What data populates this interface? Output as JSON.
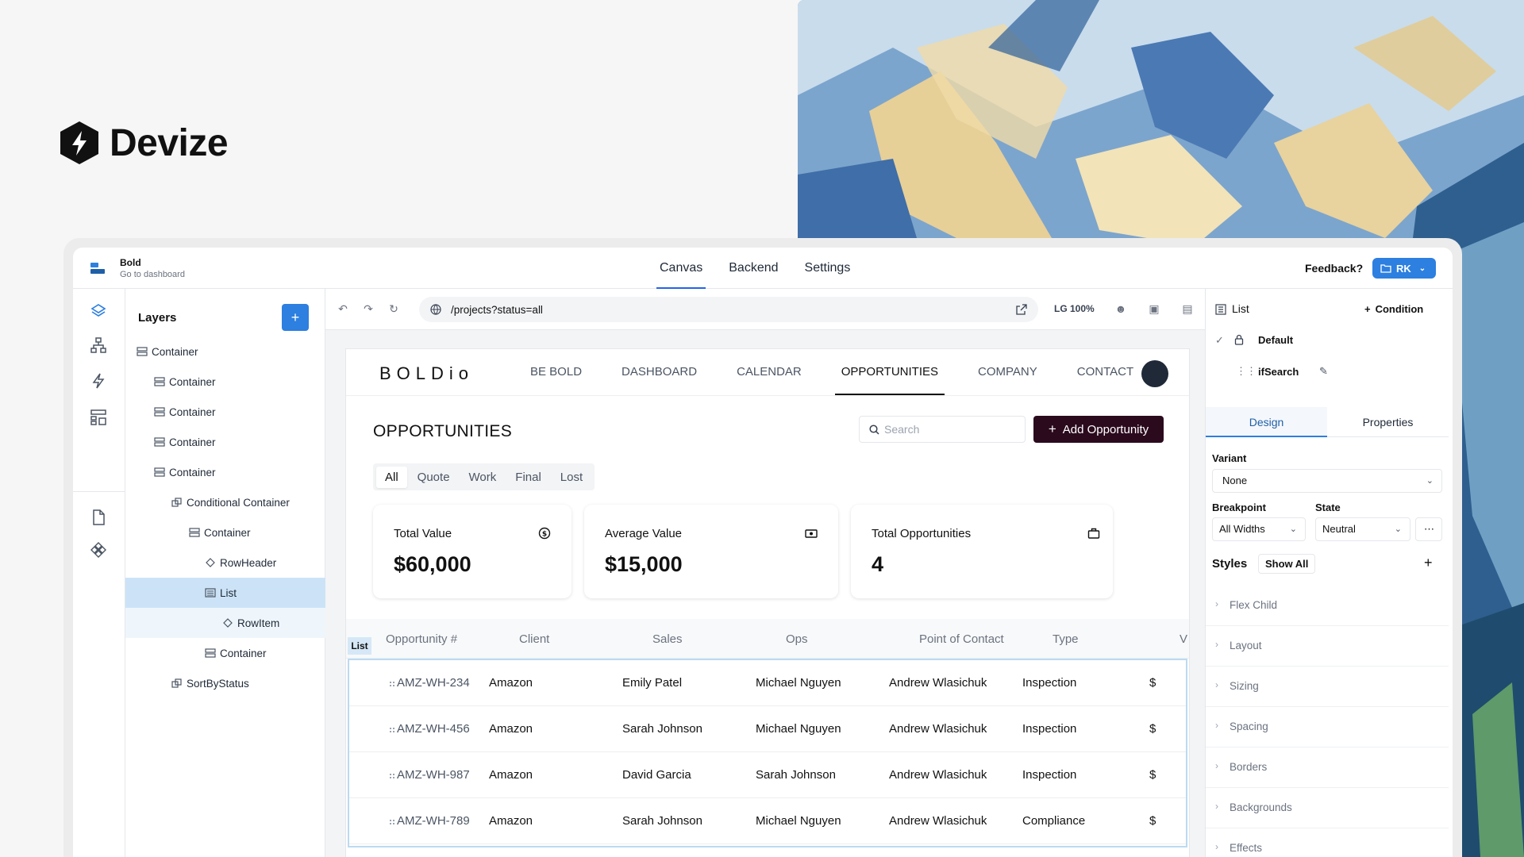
{
  "brand": {
    "name": "Devize"
  },
  "app": {
    "project_name": "Bold",
    "project_sub": "Go to dashboard",
    "nav": [
      "Canvas",
      "Backend",
      "Settings"
    ],
    "active_nav": "Canvas",
    "feedback": "Feedback?",
    "user_initials": "RK"
  },
  "layers": {
    "title": "Layers",
    "add_label": "+",
    "items": [
      {
        "label": "Container",
        "icon": "container-icon"
      },
      {
        "label": "Container",
        "icon": "container-icon"
      },
      {
        "label": "Container",
        "icon": "container-icon"
      },
      {
        "label": "Container",
        "icon": "container-icon"
      },
      {
        "label": "Container",
        "icon": "container-icon"
      },
      {
        "label": "Conditional Container",
        "icon": "conditional-icon"
      },
      {
        "label": "Container",
        "icon": "container-icon"
      },
      {
        "label": "RowHeader",
        "icon": "component-icon"
      },
      {
        "label": "List",
        "icon": "list-icon",
        "selected": true
      },
      {
        "label": "RowItem",
        "icon": "component-icon"
      },
      {
        "label": "Container",
        "icon": "container-icon"
      },
      {
        "label": "SortByStatus",
        "icon": "conditional-icon"
      }
    ]
  },
  "canvas": {
    "url": "/projects?status=all",
    "zoom": "LG 100%"
  },
  "preview": {
    "logo": "BOLDio",
    "nav": [
      "BE BOLD",
      "DASHBOARD",
      "CALENDAR",
      "OPPORTUNITIES",
      "COMPANY",
      "CONTACT"
    ],
    "active_nav": "OPPORTUNITIES",
    "title": "OPPORTUNITIES",
    "search_placeholder": "Search",
    "add_button": "Add Opportunity",
    "filters": [
      "All",
      "Quote",
      "Work",
      "Final",
      "Lost"
    ],
    "active_filter": "All",
    "stats": [
      {
        "label": "Total Value",
        "value": "$60,000",
        "icon": "dollar-icon"
      },
      {
        "label": "Average Value",
        "value": "$15,000",
        "icon": "cash-icon"
      },
      {
        "label": "Total Opportunities",
        "value": "4",
        "icon": "briefcase-icon"
      }
    ],
    "list_tag": "List",
    "columns": [
      "Opportunity #",
      "Client",
      "Sales",
      "Ops",
      "Point of Contact",
      "Type",
      "V"
    ],
    "rows": [
      {
        "id": "AMZ-WH-234",
        "client": "Amazon",
        "sales": "Emily Patel",
        "ops": "Michael Nguyen",
        "contact": "Andrew Wlasichuk",
        "type": "Inspection",
        "value": "$"
      },
      {
        "id": "AMZ-WH-456",
        "client": "Amazon",
        "sales": "Sarah Johnson",
        "ops": "Michael Nguyen",
        "contact": "Andrew Wlasichuk",
        "type": "Inspection",
        "value": "$"
      },
      {
        "id": "AMZ-WH-987",
        "client": "Amazon",
        "sales": "David Garcia",
        "ops": "Sarah Johnson",
        "contact": "Andrew Wlasichuk",
        "type": "Inspection",
        "value": "$"
      },
      {
        "id": "AMZ-WH-789",
        "client": "Amazon",
        "sales": "Sarah Johnson",
        "ops": "Michael Nguyen",
        "contact": "Andrew Wlasichuk",
        "type": "Compliance",
        "value": "$"
      }
    ]
  },
  "inspector": {
    "element": "List",
    "condition": "Condition",
    "conditions": [
      "Default",
      "ifSearch"
    ],
    "tabs": [
      "Design",
      "Properties"
    ],
    "active_tab": "Design",
    "variant_label": "Variant",
    "variant_value": "None",
    "breakpoint_label": "Breakpoint",
    "breakpoint_value": "All Widths",
    "state_label": "State",
    "state_value": "Neutral",
    "styles_label": "Styles",
    "show_all": "Show All",
    "sections": [
      "Flex Child",
      "Layout",
      "Sizing",
      "Spacing",
      "Borders",
      "Backgrounds",
      "Effects"
    ]
  },
  "colors": {
    "accent": "#2d7fe0",
    "primary_button": "#2b0a1e",
    "selection": "#cce3f7"
  }
}
